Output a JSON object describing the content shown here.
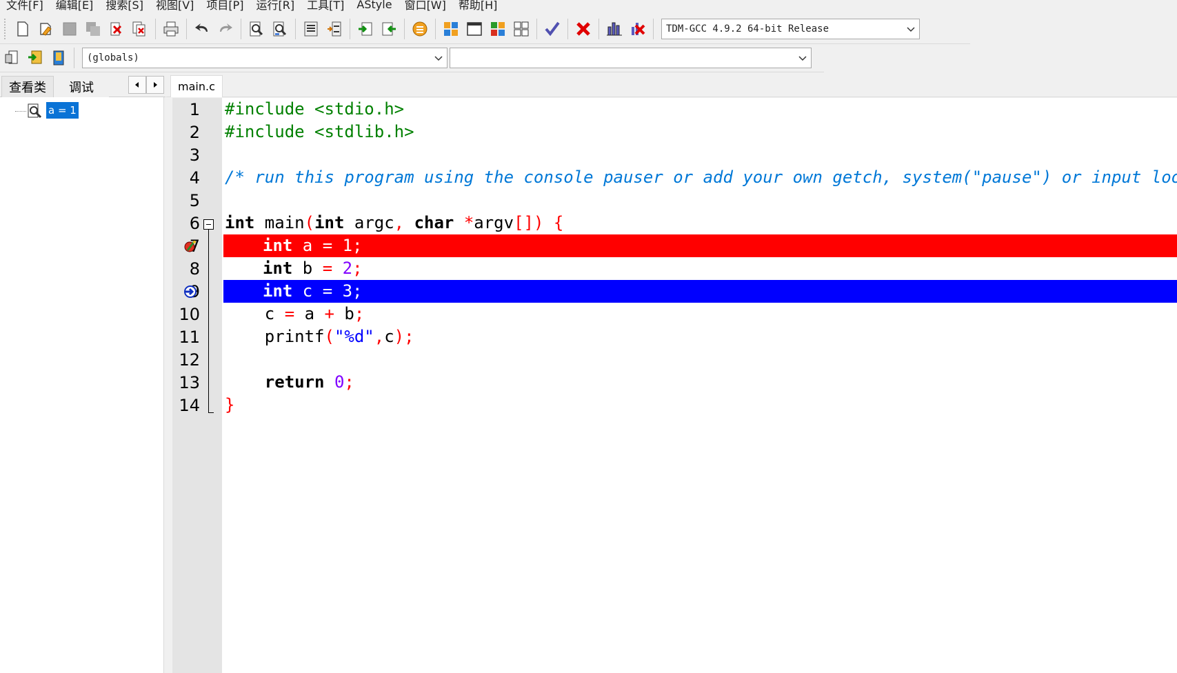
{
  "menu": [
    "文件[F]",
    "编辑[E]",
    "搜索[S]",
    "视图[V]",
    "项目[P]",
    "运行[R]",
    "工具[T]",
    "AStyle",
    "窗口[W]",
    "帮助[H]"
  ],
  "toolbar": {
    "compiler": "TDM-GCC 4.9.2 64-bit Release",
    "globals": "(globals)",
    "second_combo": ""
  },
  "left_tabs": {
    "classes": "查看类",
    "debug": "调试"
  },
  "watch": {
    "item": "a = 1"
  },
  "editor": {
    "file_tab": "main.c",
    "breakpoint_line": 7,
    "current_line": 9,
    "lines": [
      {
        "num": "1"
      },
      {
        "num": "2"
      },
      {
        "num": "3"
      },
      {
        "num": "4"
      },
      {
        "num": "5"
      },
      {
        "num": "6"
      },
      {
        "num": "7"
      },
      {
        "num": "8"
      },
      {
        "num": "9"
      },
      {
        "num": "10"
      },
      {
        "num": "11"
      },
      {
        "num": "12"
      },
      {
        "num": "13"
      },
      {
        "num": "14"
      }
    ],
    "code": {
      "l1": "#include <stdio.h>",
      "l2": "#include <stdlib.h>",
      "l4": "/* run this program using the console pauser or add your own getch, system(\"pause\") or input loop */",
      "l6_int": "int",
      "l6_main": " main",
      "l6_p1": "(",
      "l6_int2": "int",
      "l6_argc": " argc",
      "l6_comma": ",",
      "l6_char": " char",
      "l6_star": " *",
      "l6_argv": "argv",
      "l6_br": "[])",
      "l6_brace": " {",
      "l7_int": "int",
      "l7_rest": " a = 1;",
      "l8_int": "int",
      "l8_b": " b ",
      "l8_eq": "=",
      "l8_num": " 2",
      "l8_semi": ";",
      "l9_int": "int",
      "l9_rest": " c = 3;",
      "l10_c": "c ",
      "l10_eq": "=",
      "l10_a": " a ",
      "l10_plus": "+",
      "l10_b": " b",
      "l10_semi": ";",
      "l11_fn": "printf",
      "l11_p1": "(",
      "l11_str": "\"%d\"",
      "l11_comma": ",",
      "l11_c": "c",
      "l11_end": ");",
      "l13_ret": "return",
      "l13_num": " 0",
      "l13_semi": ";",
      "l14_brace": "}"
    }
  }
}
